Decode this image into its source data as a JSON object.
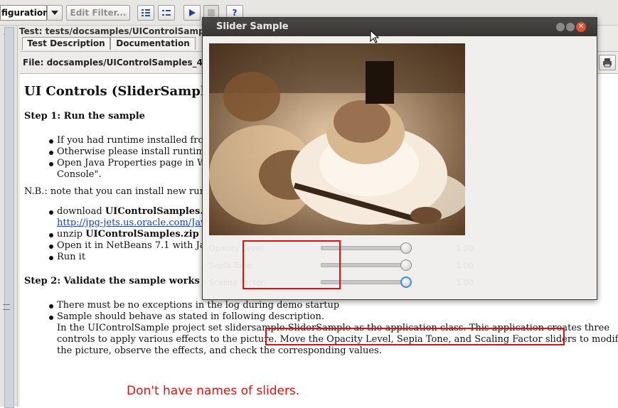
{
  "toolbar": {
    "config_value": "figuration",
    "filter_placeholder": "Edit Filter..."
  },
  "test_panel": {
    "test_label": "Test: tests/docsamples/UIControlSampl",
    "tabs": [
      "Test Description",
      "Documentation"
    ],
    "file_prefix": "File:",
    "file_path": "docsamples/UIControlSamples_49."
  },
  "document": {
    "title": "UI Controls (SliderSample",
    "step1": "Step 1: Run the sample",
    "step1_items": [
      "If you had runtime installed fron",
      "Otherwise please install runtime",
      "Open Java Properties page in W"
    ],
    "step1_cont": "Console\".",
    "nb": "N.B.: note that you can install new runt",
    "dl_prefix": "download ",
    "dl_bold": "UIControlSamples.z",
    "dl_link": "http://jpg-jets.us.oracle.com/Jav",
    "unzip_prefix": "unzip ",
    "unzip_bold": "UIControlSamples.zip",
    "open_item": "Open it in NetBeans 7.1 with Jav",
    "run_item": "Run it",
    "step2": "Step 2: Validate the sample works",
    "step2_items": [
      "There must be no exceptions in the log during demo startup",
      "Sample should behave as stated in following description."
    ],
    "desc_lines": [
      "In the UIControlSample project set slidersample.SliderSample as the application class. This application creates three",
      "controls to apply various effects to the picture. Move the Opacity Level, Sepia Tone, and Scaling Factor sliders to modify",
      "the picture, observe the effects, and check the corresponding values."
    ],
    "annotation": "Don't have names of sliders."
  },
  "dialog": {
    "title": "Slider Sample",
    "sliders": [
      {
        "label": "Opacity Level:",
        "value": "1.00",
        "level": 1.0
      },
      {
        "label": "Sepia Tone:",
        "value": "1.00",
        "level": 1.0
      },
      {
        "label": "Scaling Factor:",
        "value": "1.00",
        "level": 1.0
      }
    ]
  },
  "colors": {
    "annotation_red": "#e01010",
    "knob_focus": "#3b8ee0"
  }
}
